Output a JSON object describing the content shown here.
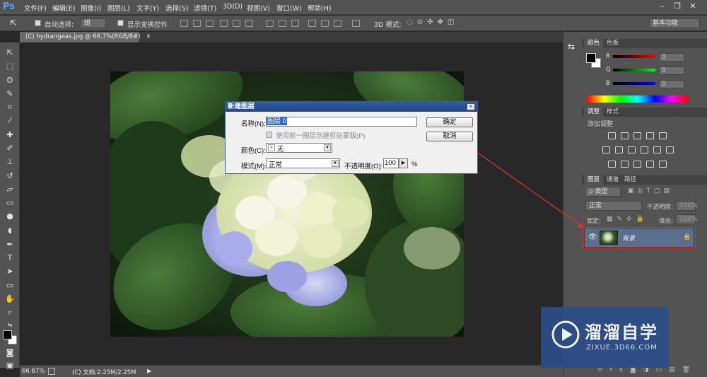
{
  "app": {
    "logo": "Ps"
  },
  "menu": {
    "items": [
      "文件(F)",
      "编辑(E)",
      "图像(I)",
      "图层(L)",
      "文字(Y)",
      "选择(S)",
      "滤镜(T)",
      "3D(D)",
      "视图(V)",
      "窗口(W)",
      "帮助(H)"
    ]
  },
  "options": {
    "auto_select_label": "自动选择:",
    "auto_select_value": "组",
    "show_transform_label": "显示变换控件",
    "mode_3d_label": "3D 模式:",
    "workspace": "基本功能"
  },
  "document": {
    "tab_title": "(C) hydrangeas.jpg @ 66.7%(RGB/8#)",
    "close": "×"
  },
  "status": {
    "zoom": "66.67%",
    "doc_size": "(C) 文档:2.25M/2.25M"
  },
  "color_panel": {
    "tabs": [
      "颜色",
      "色板"
    ],
    "channels": [
      {
        "name": "R",
        "value": "0"
      },
      {
        "name": "G",
        "value": "0"
      },
      {
        "name": "B",
        "value": "0"
      }
    ]
  },
  "adjust_panel": {
    "tabs": [
      "调整",
      "样式"
    ],
    "title": "添加调整"
  },
  "layers_panel": {
    "tabs": [
      "图层",
      "通道",
      "路径"
    ],
    "kind": "ρ 类型",
    "blend": "正常",
    "opacity_label": "不透明度:",
    "opacity_value": "100%",
    "lock_label": "锁定:",
    "fill_label": "填充:",
    "fill_value": "100%",
    "layer_name": "背景"
  },
  "dialog": {
    "title": "新建图层",
    "close": "×",
    "name_label": "名称(N):",
    "name_value": "图层 0",
    "clip_label": "使用前一图层创建剪贴蒙版(P)",
    "color_label": "颜色(C):",
    "color_value": "无",
    "color_icon": "×",
    "mode_label": "模式(M):",
    "mode_value": "正常",
    "opacity_label": "不透明度(O):",
    "opacity_value": "100",
    "percent": "%",
    "ok": "确定",
    "cancel": "取消"
  },
  "watermark": {
    "brand": "溜溜自学",
    "url": "ZIXUE.3D66.COM"
  },
  "colors": {
    "panel": "#535353",
    "canvas": "#282828",
    "dialog_title": "#2f5aa0",
    "selected_layer": "#5a6e8e",
    "annotation": "#e03030",
    "watermark": "#2d4d8a"
  }
}
